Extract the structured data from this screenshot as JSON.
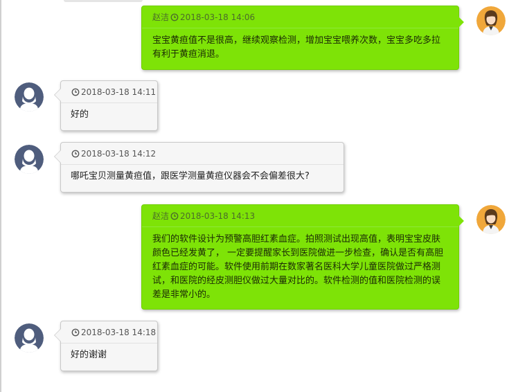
{
  "messages": [
    {
      "side": "right",
      "sender": "赵洁",
      "time": "2018-03-18 14:06",
      "text": "宝宝黄疸值不是很高，继续观察检测，增加宝宝喂养次数，宝宝多吃多拉有利于黄疸消退。"
    },
    {
      "side": "left",
      "time": "2018-03-18 14:11",
      "text": "好的"
    },
    {
      "side": "left",
      "time": "2018-03-18 14:12",
      "text": "哪吒宝贝测量黄疸值，跟医学测量黄疸仪器会不会偏差很大?"
    },
    {
      "side": "right",
      "sender": "赵洁",
      "time": "2018-03-18 14:13",
      "text": "我们的软件设计为预警高胆红素血症。拍照测试出现高值，表明宝宝皮肤颜色已经发黄了， 一定要提醒家长到医院做进一步检查，确认是否有高胆红素血症的可能。软件使用前期在数家著名医科大学儿童医院做过严格测试，和医院的经皮测胆仪做过大量对比的。软件检测的值和医院检测的误差是非常小的。"
    },
    {
      "side": "left",
      "time": "2018-03-18 14:18",
      "text": "好的谢谢"
    }
  ],
  "icons": {
    "clock": "clock-icon",
    "doctor_avatar": "doctor-avatar",
    "user_avatar": "user-avatar"
  },
  "colors": {
    "right_bubble": "#7ee307",
    "left_bubble": "#f6f6f6",
    "doctor_avatar_bg": "#f0a73a",
    "user_avatar_bg": "#4f5d7d"
  }
}
